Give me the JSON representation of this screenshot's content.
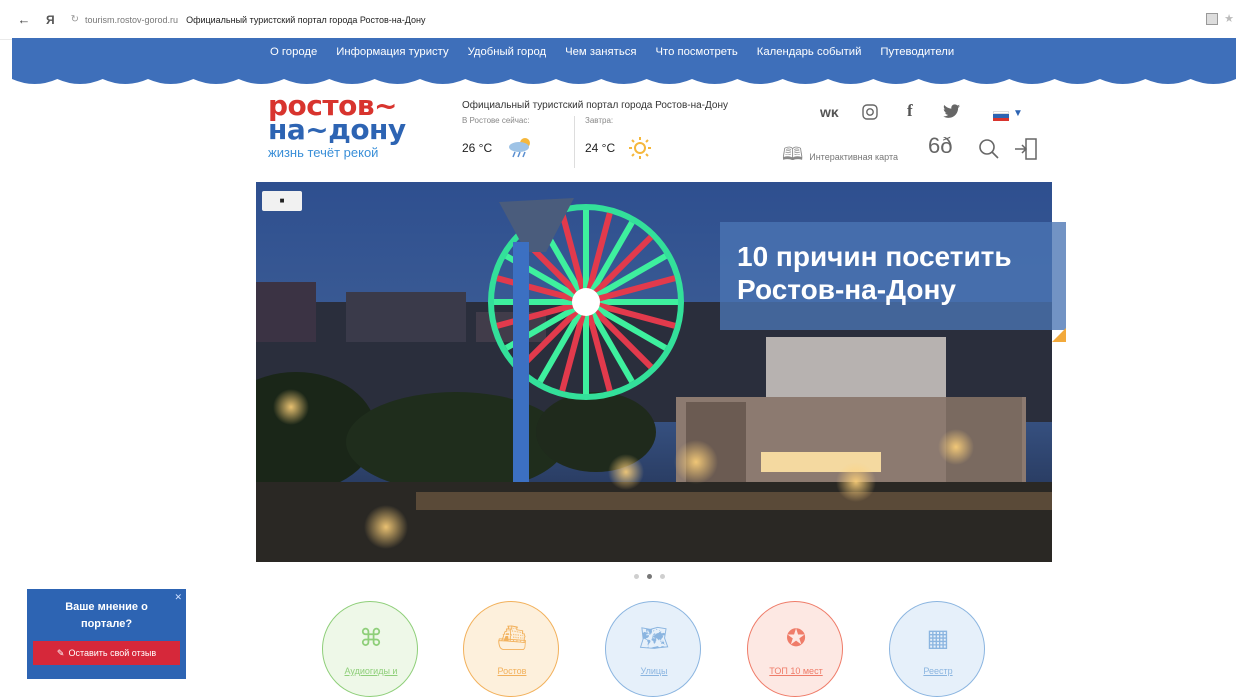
{
  "browser": {
    "domain": "tourism.rostov-gorod.ru",
    "page_title": "Официальный туристский портал города Ростов-на-Дону",
    "back_icon": "←",
    "yandex_label": "Я"
  },
  "nav": {
    "items": [
      "О городе",
      "Информация туристу",
      "Удобный город",
      "Чем заняться",
      "Что посмотреть",
      "Календарь событий",
      "Путеводители"
    ]
  },
  "logo": {
    "line1": "ростов~",
    "line2": "на~дону",
    "tagline": "жизнь течёт рекой"
  },
  "header": {
    "portal_title": "Официальный туристский портал города Ростов-на-Дону",
    "weather_now_label": "В Ростове сейчас:",
    "weather_now_temp": "26 °C",
    "weather_tomorrow_label": "Завтра:",
    "weather_tomorrow_temp": "24 °C",
    "map_label": "Интерактивная карта"
  },
  "social": {
    "vk": "ᴡᴋ",
    "instagram": "◎",
    "facebook": "f",
    "twitter": "🐦"
  },
  "hero": {
    "caption_line1": "10 причин посетить",
    "caption_line2": "Ростов-на-Дону",
    "video_icon": "■"
  },
  "feedback": {
    "question_line1": "Ваше мнение о",
    "question_line2": "портале?",
    "button_label": "Оставить свой отзыв"
  },
  "categories": [
    {
      "label": "Аудиогиды и",
      "color": "#8fcf7a",
      "bg": "#eef8e8",
      "icon": "⌘"
    },
    {
      "label": "Ростов",
      "color": "#f2b15c",
      "bg": "#fdf0dc",
      "icon": "⛴"
    },
    {
      "label": "Улицы",
      "color": "#8bb5e0",
      "bg": "#e6f0fa",
      "icon": "🗺"
    },
    {
      "label": "ТОП 10 мест",
      "color": "#ef7c69",
      "bg": "#fde8e3",
      "icon": "✪"
    },
    {
      "label": "Реестр",
      "color": "#8bb5e0",
      "bg": "#e6f0fa",
      "icon": "▦"
    }
  ],
  "colors": {
    "brand_blue": "#2d64b3",
    "nav_blue": "#3e6fba",
    "logo_red": "#d8342e",
    "logo_green": "#6fbf4a",
    "feedback_red": "#d6283a"
  }
}
